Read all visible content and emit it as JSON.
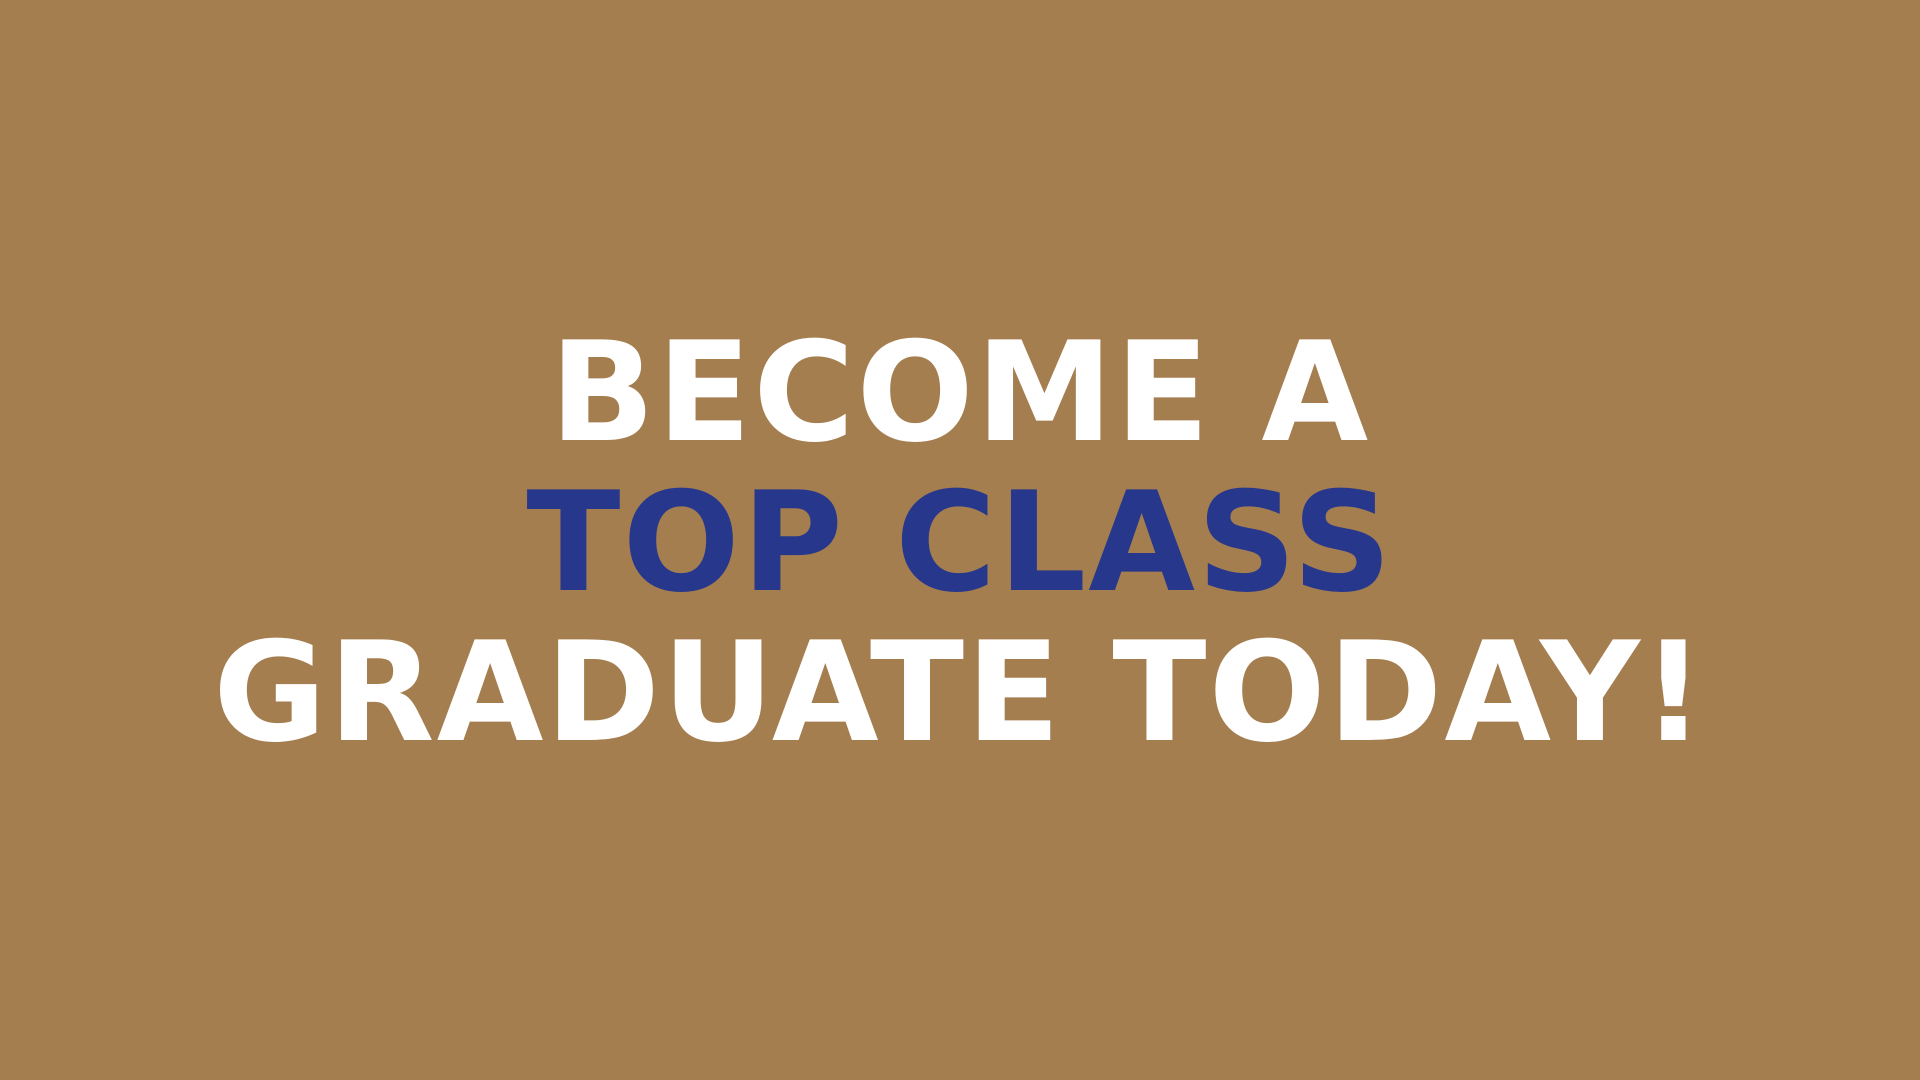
{
  "background_color": "#a57e50",
  "headline": {
    "line_1": "BECOME A",
    "line_2": "TOP CLASS",
    "line_3": "GRADUATE TODAY!",
    "line_1_color": "#ffffff",
    "line_2_color": "#27388c",
    "line_3_color": "#ffffff"
  }
}
